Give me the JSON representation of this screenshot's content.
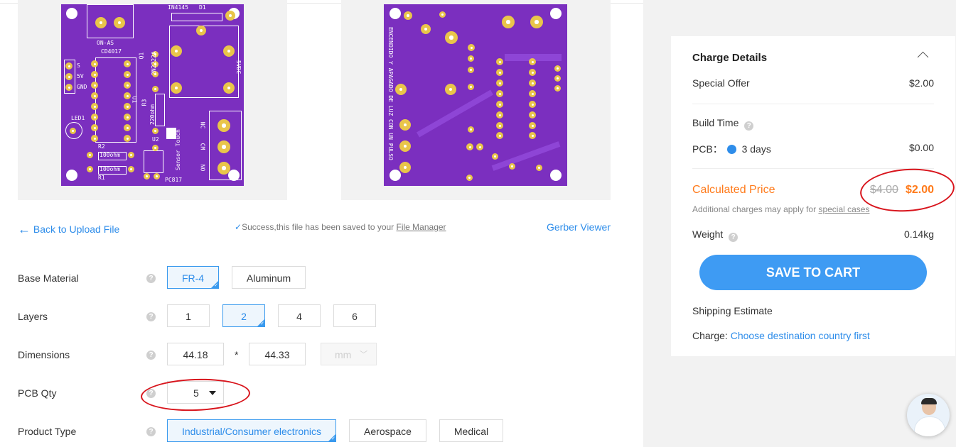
{
  "pcb_top": {
    "labels": {
      "ic1": "CD4017",
      "q": "Q1",
      "transistor": "2N2222A",
      "diode": "IN4145",
      "d1": "D1",
      "relay_v": "5VDC",
      "r3": "R3",
      "r3v": "220ohm",
      "u1": "U1",
      "u2": "U2",
      "led": "LED1",
      "r2": "R2",
      "r1": "R1",
      "r2v": "100ohm",
      "r1v": "100ohm",
      "opto": "PC817",
      "s": "S",
      "v5": "5V",
      "gnd": "GND",
      "onoff": "ON-AS",
      "sensor": "Sensor Touch",
      "nc": "NC",
      "cm": "CM",
      "no": "NO"
    }
  },
  "pcb_bottom": {
    "vertical_text": "ENCENDIDO Y APAGADO DE LUZ CON UN PULSO"
  },
  "links": {
    "back": "Back to Upload File",
    "success_prefix": "Success,this file has been saved to your ",
    "file_manager": "File Manager",
    "gerber_viewer": "Gerber Viewer"
  },
  "form": {
    "base_material": {
      "label": "Base Material",
      "options": [
        "FR-4",
        "Aluminum"
      ],
      "selected": "FR-4"
    },
    "layers": {
      "label": "Layers",
      "options": [
        "1",
        "2",
        "4",
        "6"
      ],
      "selected": "2"
    },
    "dimensions": {
      "label": "Dimensions",
      "width": "44.18",
      "height": "44.33",
      "separator": "*",
      "unit": "mm"
    },
    "pcb_qty": {
      "label": "PCB Qty",
      "value": "5"
    },
    "product_type": {
      "label": "Product Type",
      "options": [
        "Industrial/Consumer electronics",
        "Aerospace",
        "Medical"
      ],
      "selected": "Industrial/Consumer electronics"
    }
  },
  "charge": {
    "title": "Charge Details",
    "special_offer_label": "Special Offer",
    "special_offer_value": "$2.00",
    "build_time_label": "Build Time",
    "pcb_label": "PCB：",
    "pcb_option": "3 days",
    "pcb_value": "$0.00",
    "calc_label": "Calculated Price",
    "old_price": "$4.00",
    "new_price": "$2.00",
    "note_prefix": "Additional charges may apply for ",
    "note_link": "special cases",
    "weight_label": "Weight",
    "weight_value": "0.14kg",
    "save_button": "SAVE TO CART",
    "shipping_label": "Shipping Estimate",
    "charge_label": "Charge:",
    "charge_link": "Choose destination country first"
  },
  "colors": {
    "accent": "#2e8dea",
    "orange": "#ff7a1a",
    "pcb_purple": "#7b2fbf",
    "annotation_red": "#d8141c"
  }
}
